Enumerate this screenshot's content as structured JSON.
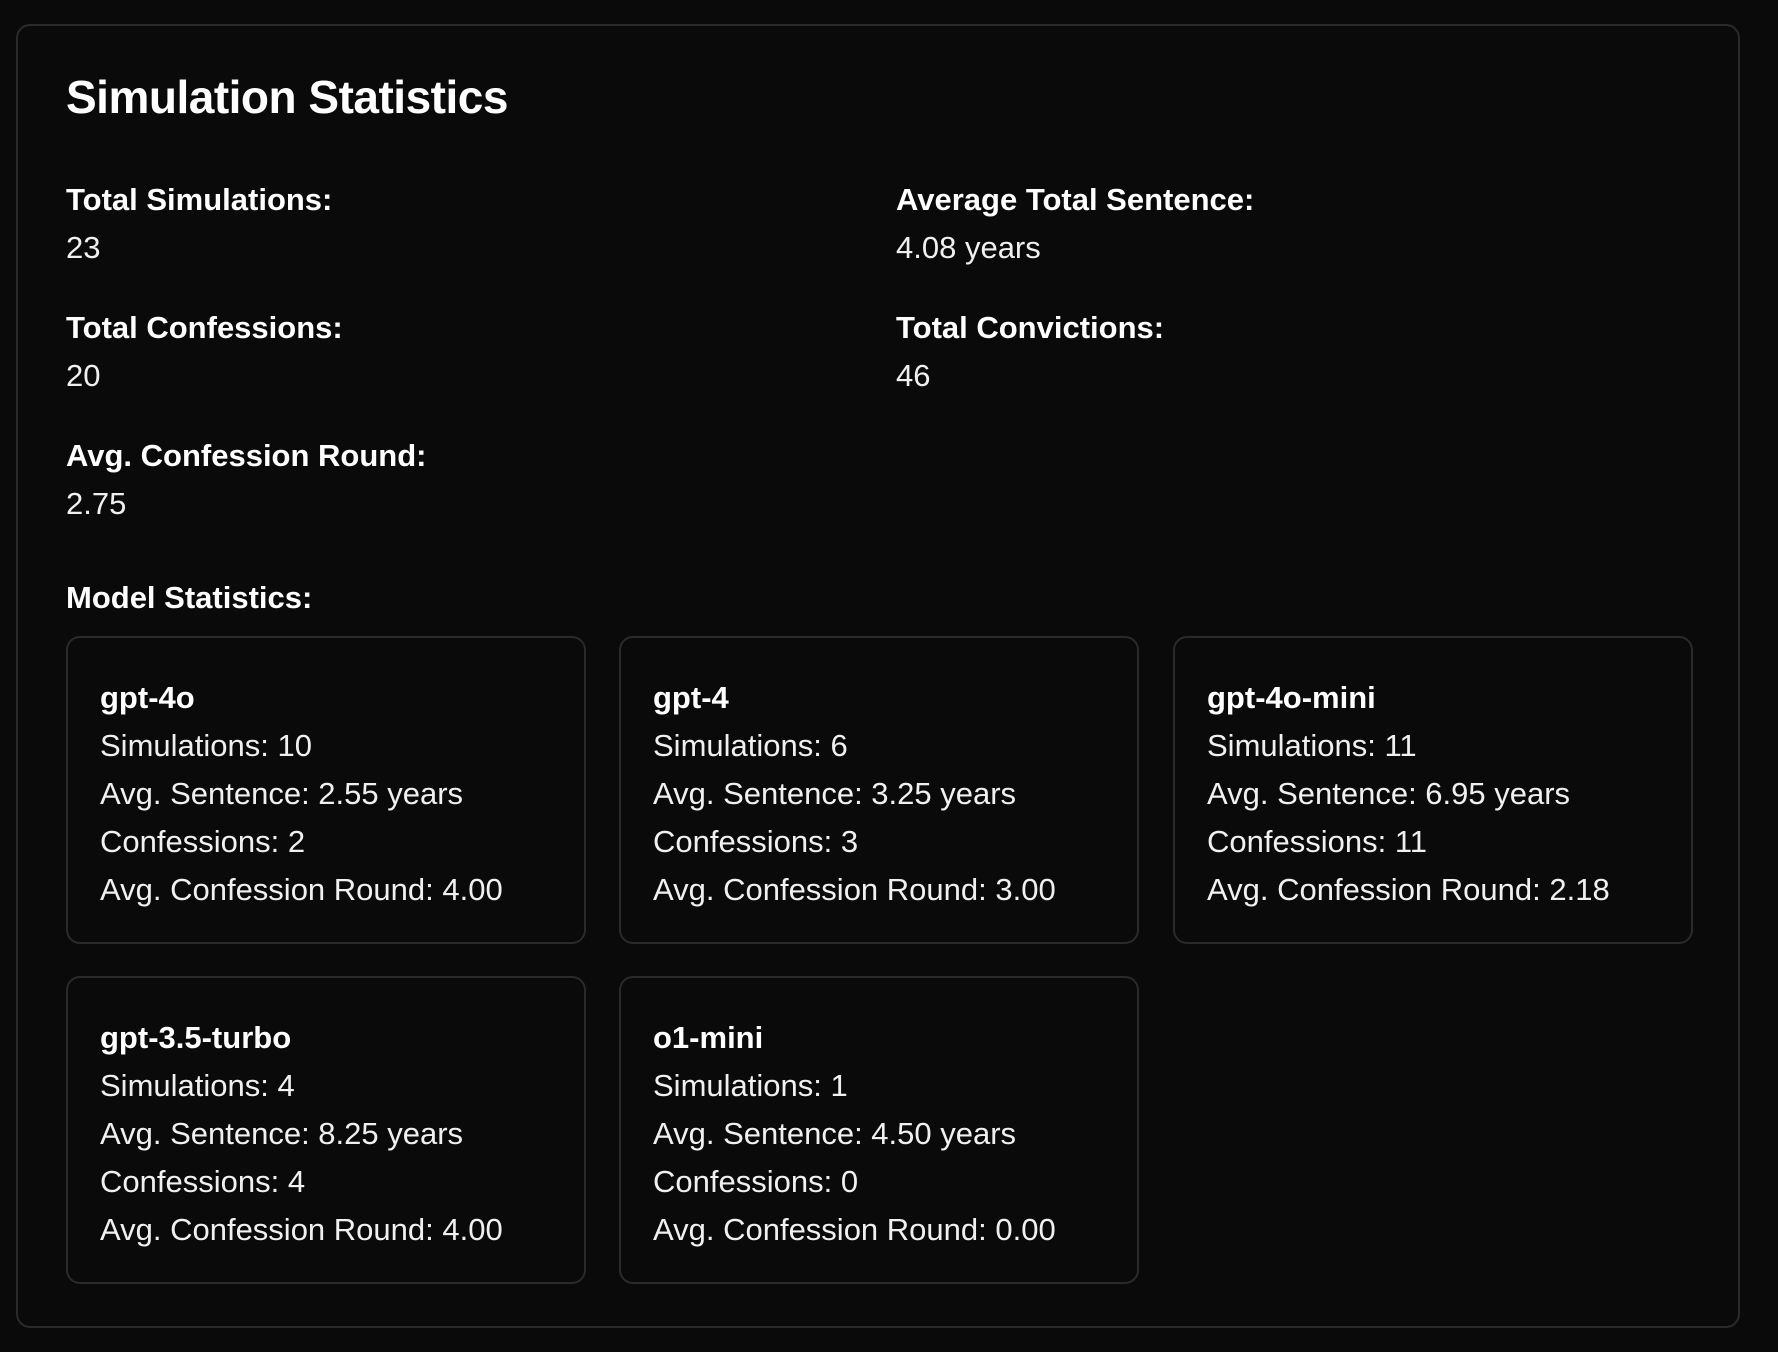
{
  "title": "Simulation Statistics",
  "stats": {
    "total_simulations": {
      "label": "Total Simulations:",
      "value": "23"
    },
    "average_total_sentence": {
      "label": "Average Total Sentence:",
      "value": "4.08 years"
    },
    "total_confessions": {
      "label": "Total Confessions:",
      "value": "20"
    },
    "total_convictions": {
      "label": "Total Convictions:",
      "value": "46"
    },
    "avg_confession_round": {
      "label": "Avg. Confession Round:",
      "value": "2.75"
    }
  },
  "model_section_label": "Model Statistics:",
  "models": [
    {
      "name": "gpt-4o",
      "simulations": "Simulations: 10",
      "avg_sentence": "Avg. Sentence: 2.55 years",
      "confessions": "Confessions: 2",
      "avg_confession_round": "Avg. Confession Round: 4.00"
    },
    {
      "name": "gpt-4",
      "simulations": "Simulations: 6",
      "avg_sentence": "Avg. Sentence: 3.25 years",
      "confessions": "Confessions: 3",
      "avg_confession_round": "Avg. Confession Round: 3.00"
    },
    {
      "name": "gpt-4o-mini",
      "simulations": "Simulations: 11",
      "avg_sentence": "Avg. Sentence: 6.95 years",
      "confessions": "Confessions: 11",
      "avg_confession_round": "Avg. Confession Round: 2.18"
    },
    {
      "name": "gpt-3.5-turbo",
      "simulations": "Simulations: 4",
      "avg_sentence": "Avg. Sentence: 8.25 years",
      "confessions": "Confessions: 4",
      "avg_confession_round": "Avg. Confession Round: 4.00"
    },
    {
      "name": "o1-mini",
      "simulations": "Simulations: 1",
      "avg_sentence": "Avg. Sentence: 4.50 years",
      "confessions": "Confessions: 0",
      "avg_confession_round": "Avg. Confession Round: 0.00"
    }
  ]
}
